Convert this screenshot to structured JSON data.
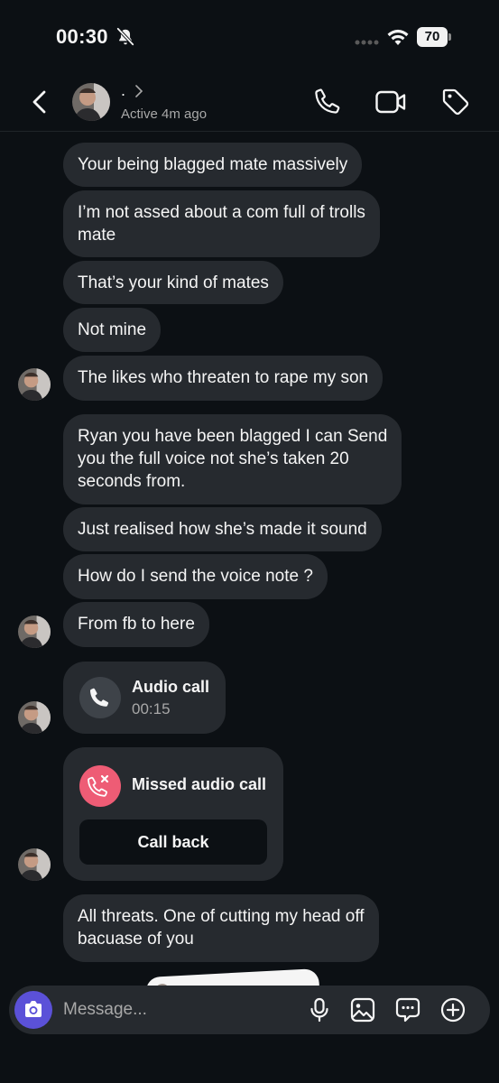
{
  "status_bar": {
    "time": "00:30",
    "battery": "70"
  },
  "header": {
    "contact_name": ".",
    "active_status": "Active 4m ago"
  },
  "messages": [
    {
      "text": "Your being blagged mate massively"
    },
    {
      "text": "I’m not assed about a com full of trolls\nmate"
    },
    {
      "text": "That’s your kind of mates"
    },
    {
      "text": "Not mine"
    },
    {
      "text": "The likes who threaten to rape my son"
    },
    {
      "text": "Ryan you have been blagged I can Send\nyou the full voice not she’s taken 20\nseconds from."
    },
    {
      "text": "Just realised how she’s made it sound"
    },
    {
      "text": "How do I send the voice note ?"
    },
    {
      "text": "From fb to here"
    },
    {
      "text": "All threats. One of cutting my head off\nbacuase of you"
    }
  ],
  "audio_call": {
    "title": "Audio call",
    "duration": "00:15"
  },
  "missed_call": {
    "title": "Missed audio call",
    "action": "Call back"
  },
  "composer": {
    "placeholder": "Message..."
  },
  "colors": {
    "background": "#0c1014",
    "bubble": "#262a2f",
    "camera_button": "#5b51d8",
    "missed_call_icon": "#ee5c75"
  }
}
